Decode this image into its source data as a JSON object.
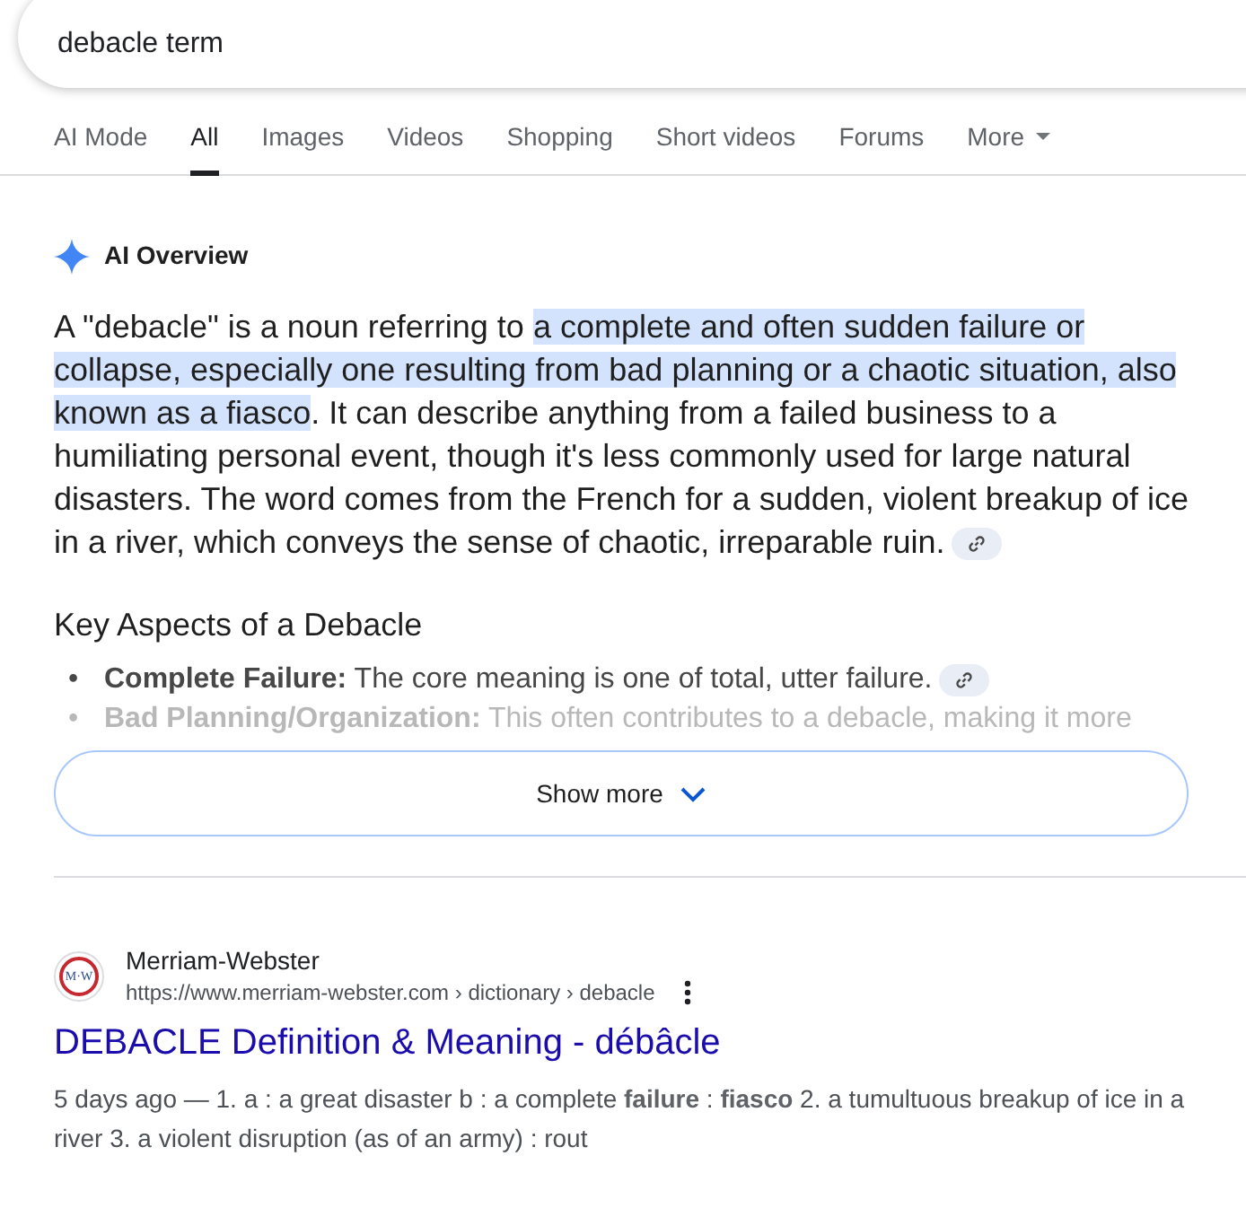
{
  "search": {
    "value": "debacle term"
  },
  "tabs": [
    {
      "label": "AI Mode",
      "selected": false
    },
    {
      "label": "All",
      "selected": true
    },
    {
      "label": "Images",
      "selected": false
    },
    {
      "label": "Videos",
      "selected": false
    },
    {
      "label": "Shopping",
      "selected": false
    },
    {
      "label": "Short videos",
      "selected": false
    },
    {
      "label": "Forums",
      "selected": false
    },
    {
      "label": "More",
      "selected": false,
      "dropdown": true
    }
  ],
  "ai_overview": {
    "title": "AI Overview",
    "paragraph": [
      {
        "text": "A \"debacle\" is a noun referring to ",
        "highlighted": false
      },
      {
        "text": "a complete and often sudden failure or collapse, especially one resulting from bad planning or a chaotic situation, also known as a fiasco",
        "highlighted": true
      },
      {
        "text": ". It can describe anything from a failed business to a humiliating personal event, though it's less commonly used for large natural disasters. The word comes from the French for a sudden, violent breakup of ice in a river, which conveys the sense of chaotic, irreparable ruin.",
        "highlighted": false
      }
    ],
    "heading": "Key Aspects of a Debacle",
    "bullets": [
      {
        "marker": "•",
        "text": "**Complete Failure:** The core meaning is one of total, utter failure.",
        "faded": false,
        "link": true
      },
      {
        "marker": "•",
        "text": "**Bad Planning/Organization:** This often contributes to a debacle, making it more",
        "faded": true,
        "link": false
      }
    ],
    "show_more": "Show more"
  },
  "result": {
    "logo": "M·W",
    "site": "Merriam-Webster",
    "url": "https://www.merriam-webster.com › dictionary › debacle",
    "title": "DEBACLE Definition & Meaning - débâcle",
    "snippet": "5 days ago — 1. a : a great disaster b : a complete **failure** : **fiasco** 2. a tumultuous breakup of ice in a river 3. a violent disruption (as of an army) : rout"
  }
}
